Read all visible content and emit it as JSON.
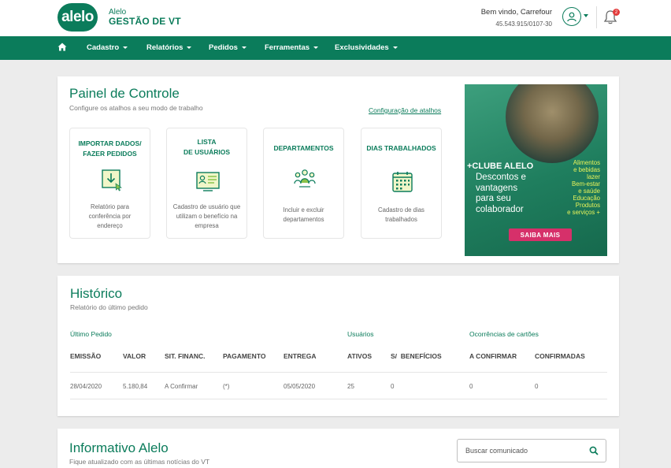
{
  "header": {
    "logo_text": "alelo",
    "brand_sub": "Alelo",
    "brand_main": "GESTÃO DE VT",
    "welcome": "Bem vindo, Carrefour",
    "cnpj": "45.543.915/0107-30",
    "notification_count": "2"
  },
  "nav": {
    "items": [
      {
        "label": "Cadastro"
      },
      {
        "label": "Relatórios"
      },
      {
        "label": "Pedidos"
      },
      {
        "label": "Ferramentas"
      },
      {
        "label": "Exclusividades"
      }
    ]
  },
  "panel": {
    "title": "Painel de Controle",
    "subtitle": "Configure os atalhos a seu modo de trabalho",
    "config_link": "Configuração de atalhos",
    "tiles": [
      {
        "title_line1": "IMPORTAR DADOS/",
        "title_line2": "FAZER PEDIDOS",
        "desc_line1": "Relatório para",
        "desc_line2": "conferência por",
        "desc_line3": "endereço",
        "icon": "download-icon"
      },
      {
        "title_line1": "LISTA",
        "title_line2": "DE USUÁRIOS",
        "desc_line1": "Cadastro de usuário que",
        "desc_line2": "utilizam o benefício na",
        "desc_line3": "empresa",
        "icon": "user-list-icon"
      },
      {
        "title_line1": "DEPARTAMENTOS",
        "title_line2": "",
        "desc_line1": "Incluir e excluir",
        "desc_line2": "departamentos",
        "desc_line3": "",
        "icon": "team-icon"
      },
      {
        "title_line1": "DIAS TRABALHADOS",
        "title_line2": "",
        "desc_line1": "Cadastro de dias",
        "desc_line2": "trabalhados",
        "desc_line3": "",
        "icon": "calendar-icon"
      }
    ],
    "promo": {
      "title": "+CLUBE ALELO",
      "text_line1": "Descontos e",
      "text_line2": "vantagens",
      "text_line3": "para seu",
      "text_line4": "colaborador",
      "list": [
        "Alimentos",
        "e bebidas",
        "lazer",
        "Bem-estar",
        "e saúde",
        "Educação",
        "Produtos",
        "e serviços +"
      ],
      "button": "SAIBA MAIS"
    }
  },
  "history": {
    "title": "Histórico",
    "subtitle": "Relatório do último pedido",
    "groups": [
      "Último Pedido",
      "Usuários",
      "Ocorrências de cartões"
    ],
    "headers": [
      "EMISSÃO",
      "VALOR",
      "SIT. FINANC.",
      "PAGAMENTO",
      "ENTREGA",
      "ATIVOS",
      "S/  BENEFÍCIOS",
      "A CONFIRMAR",
      "CONFIRMADAS"
    ],
    "row": [
      "28/04/2020",
      "5.180,84",
      "A Confirmar",
      "(*)",
      "05/05/2020",
      "25",
      "0",
      "0",
      "0"
    ]
  },
  "informativo": {
    "title": "Informativo Alelo",
    "subtitle": "Fique atualizado com as últimas notícias do VT",
    "search_placeholder": "Buscar comunicado"
  },
  "colors": {
    "brand_green": "#0b7c5b",
    "promo_button": "#d6306a",
    "promo_highlight": "#e8f35a"
  }
}
